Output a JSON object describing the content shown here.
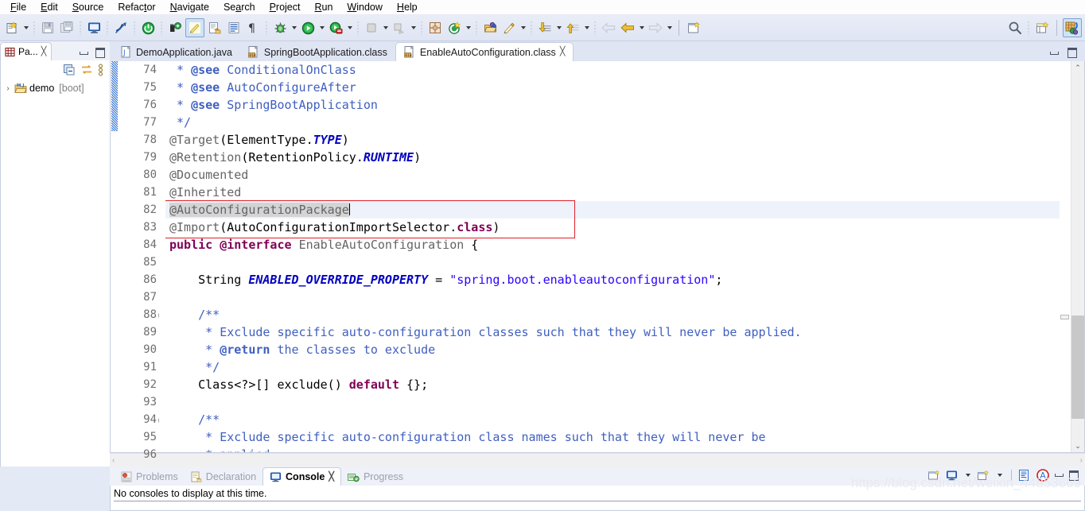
{
  "menu": {
    "items": [
      {
        "label": "File",
        "mnemonic": "F"
      },
      {
        "label": "Edit",
        "mnemonic": "E"
      },
      {
        "label": "Source",
        "mnemonic": "S"
      },
      {
        "label": "Refactor",
        "mnemonic": "t"
      },
      {
        "label": "Navigate",
        "mnemonic": "N"
      },
      {
        "label": "Search",
        "mnemonic": "a"
      },
      {
        "label": "Project",
        "mnemonic": "P"
      },
      {
        "label": "Run",
        "mnemonic": "R"
      },
      {
        "label": "Window",
        "mnemonic": "W"
      },
      {
        "label": "Help",
        "mnemonic": "H"
      }
    ]
  },
  "toolbar": {
    "icons": [
      "new-wizard-icon",
      "save-icon",
      "save-all-icon",
      "open-console-icon",
      "toggle-mark-occurrences-icon",
      "terminate-icon",
      "new-java-class-icon",
      "new-java-project-icon",
      "export-icon",
      "open-type-icon",
      "pilcrow-icon",
      "debug-icon",
      "run-icon",
      "run-coverage-icon",
      "stop-icon",
      "relaunch-icon",
      "new-plugin-icon",
      "refresh-icon",
      "open-task-icon",
      "edit-annotation-icon",
      "next-annotation-icon",
      "previous-annotation-icon",
      "back-icon",
      "forward-icon",
      "new-window-icon"
    ],
    "right_icons": [
      "search-icon",
      "open-perspective-icon",
      "java-ee-perspective-icon"
    ]
  },
  "package_explorer": {
    "tab_label": "Pa...",
    "close_glyph": "╳",
    "toolbar_icons": [
      "collapse-all-icon",
      "link-with-editor-icon",
      "view-menu-icon"
    ],
    "tree": [
      {
        "twisty": "›",
        "label": "demo",
        "decoration": "[boot]",
        "icon": "java-project-icon"
      }
    ]
  },
  "editor": {
    "tabs": [
      {
        "label": "DemoApplication.java",
        "icon": "java-file-icon",
        "active": false,
        "closable": false
      },
      {
        "label": "SpringBootApplication.class",
        "icon": "class-file-icon",
        "active": false,
        "closable": false
      },
      {
        "label": "EnableAutoConfiguration.class",
        "icon": "class-file-icon",
        "active": true,
        "closable": true,
        "close_glyph": "╳"
      }
    ],
    "controls": [
      "minimize-icon",
      "maximize-icon"
    ],
    "first_line": 74,
    "lines": [
      {
        "n": 74,
        "fold": false,
        "hatch": true,
        "tokens": [
          {
            "t": " * ",
            "c": "cmt"
          },
          {
            "t": "@see",
            "c": "cmtb"
          },
          {
            "t": " ConditionalOnClass",
            "c": "cmt"
          }
        ]
      },
      {
        "n": 75,
        "fold": false,
        "hatch": true,
        "tokens": [
          {
            "t": " * ",
            "c": "cmt"
          },
          {
            "t": "@see",
            "c": "cmtb"
          },
          {
            "t": " AutoConfigureAfter",
            "c": "cmt"
          }
        ]
      },
      {
        "n": 76,
        "fold": false,
        "hatch": true,
        "tokens": [
          {
            "t": " * ",
            "c": "cmt"
          },
          {
            "t": "@see",
            "c": "cmtb"
          },
          {
            "t": " SpringBootApplication",
            "c": "cmt"
          }
        ]
      },
      {
        "n": 77,
        "fold": false,
        "hatch": true,
        "tokens": [
          {
            "t": " */",
            "c": "cmt"
          }
        ]
      },
      {
        "n": 78,
        "fold": false,
        "hatch": false,
        "tokens": [
          {
            "t": "@Target",
            "c": "ann"
          },
          {
            "t": "(ElementType.",
            "c": "plain"
          },
          {
            "t": "TYPE",
            "c": "fld"
          },
          {
            "t": ")",
            "c": "plain"
          }
        ]
      },
      {
        "n": 79,
        "fold": false,
        "hatch": false,
        "tokens": [
          {
            "t": "@Retention",
            "c": "ann"
          },
          {
            "t": "(RetentionPolicy.",
            "c": "plain"
          },
          {
            "t": "RUNTIME",
            "c": "fld"
          },
          {
            "t": ")",
            "c": "plain"
          }
        ]
      },
      {
        "n": 80,
        "fold": false,
        "hatch": false,
        "tokens": [
          {
            "t": "@Documented",
            "c": "ann"
          }
        ]
      },
      {
        "n": 81,
        "fold": false,
        "hatch": false,
        "tokens": [
          {
            "t": "@Inherited",
            "c": "ann"
          }
        ]
      },
      {
        "n": 82,
        "fold": false,
        "hatch": false,
        "current": true,
        "tokens": [
          {
            "t": "@AutoConfigurationPackage",
            "c": "ann",
            "occ": true
          },
          {
            "t": "",
            "c": "caret"
          }
        ]
      },
      {
        "n": 83,
        "fold": false,
        "hatch": false,
        "tokens": [
          {
            "t": "@Import",
            "c": "ann"
          },
          {
            "t": "(AutoConfigurationImportSelector.",
            "c": "plain"
          },
          {
            "t": "class",
            "c": "kw"
          },
          {
            "t": ")",
            "c": "plain"
          }
        ]
      },
      {
        "n": 84,
        "fold": false,
        "hatch": false,
        "tokens": [
          {
            "t": "public @interface",
            "c": "kw"
          },
          {
            "t": " ",
            "c": "plain"
          },
          {
            "t": "EnableAutoConfiguration",
            "c": "ann"
          },
          {
            "t": " {",
            "c": "plain"
          }
        ]
      },
      {
        "n": 85,
        "fold": false,
        "hatch": false,
        "tokens": []
      },
      {
        "n": 86,
        "fold": false,
        "hatch": false,
        "tokens": [
          {
            "t": "    String ",
            "c": "plain"
          },
          {
            "t": "ENABLED_OVERRIDE_PROPERTY",
            "c": "fld"
          },
          {
            "t": " = ",
            "c": "plain"
          },
          {
            "t": "\"spring.boot.enableautoconfiguration\"",
            "c": "str"
          },
          {
            "t": ";",
            "c": "plain"
          }
        ]
      },
      {
        "n": 87,
        "fold": false,
        "hatch": false,
        "tokens": []
      },
      {
        "n": 88,
        "fold": true,
        "hatch": false,
        "tokens": [
          {
            "t": "    /**",
            "c": "cmt"
          }
        ]
      },
      {
        "n": 89,
        "fold": false,
        "hatch": false,
        "tokens": [
          {
            "t": "     * Exclude specific auto-configuration classes such that they will never be applied.",
            "c": "cmt"
          }
        ]
      },
      {
        "n": 90,
        "fold": false,
        "hatch": false,
        "tokens": [
          {
            "t": "     * ",
            "c": "cmt"
          },
          {
            "t": "@return",
            "c": "cmtb"
          },
          {
            "t": " the classes to exclude",
            "c": "cmt"
          }
        ]
      },
      {
        "n": 91,
        "fold": false,
        "hatch": false,
        "tokens": [
          {
            "t": "     */",
            "c": "cmt"
          }
        ]
      },
      {
        "n": 92,
        "fold": false,
        "hatch": false,
        "tokens": [
          {
            "t": "    Class<?>[] exclude() ",
            "c": "plain"
          },
          {
            "t": "default",
            "c": "kw"
          },
          {
            "t": " {};",
            "c": "plain"
          }
        ]
      },
      {
        "n": 93,
        "fold": false,
        "hatch": false,
        "tokens": []
      },
      {
        "n": 94,
        "fold": true,
        "hatch": false,
        "tokens": [
          {
            "t": "    /**",
            "c": "cmt"
          }
        ]
      },
      {
        "n": 95,
        "fold": false,
        "hatch": false,
        "tokens": [
          {
            "t": "     * Exclude specific auto-configuration class names such that they will never be",
            "c": "cmt"
          }
        ]
      },
      {
        "n": 96,
        "fold": false,
        "hatch": false,
        "clipped": true,
        "tokens": [
          {
            "t": "     * applied.",
            "c": "cmt"
          }
        ]
      }
    ],
    "highlight_box": {
      "color": "#e0202a",
      "from_line": 82,
      "to_line": 83
    },
    "scroll": {
      "up_glyph": "⌃",
      "down_glyph": "⌄",
      "left_glyph": "‹",
      "right_glyph": "›"
    }
  },
  "bottom_panel": {
    "tabs": [
      {
        "label": "Problems",
        "icon": "problems-icon",
        "active": false
      },
      {
        "label": "Declaration",
        "icon": "declaration-icon",
        "active": false
      },
      {
        "label": "Console",
        "icon": "console-icon",
        "active": true,
        "close_glyph": "╳"
      },
      {
        "label": "Progress",
        "icon": "progress-icon",
        "active": false
      }
    ],
    "controls": [
      "open-console-icon",
      "display-selected-console-icon",
      "new-console-view-icon",
      "word-wrap-icon",
      "scroll-lock-icon",
      "minimize-icon",
      "maximize-icon"
    ],
    "message": "No consoles to display at this time."
  },
  "watermark": "https://blog.csdn.net/weixin_44853669",
  "colors": {
    "accent": "#2f6fd0",
    "highlight_box": "#e0202a",
    "keyword": "#7f0055",
    "comment": "#3f5fbf",
    "string": "#2a00ff",
    "field": "#0000c0",
    "annotation": "#646464",
    "current_line": "#eef3fb",
    "occurrence": "#d4d4d4"
  }
}
